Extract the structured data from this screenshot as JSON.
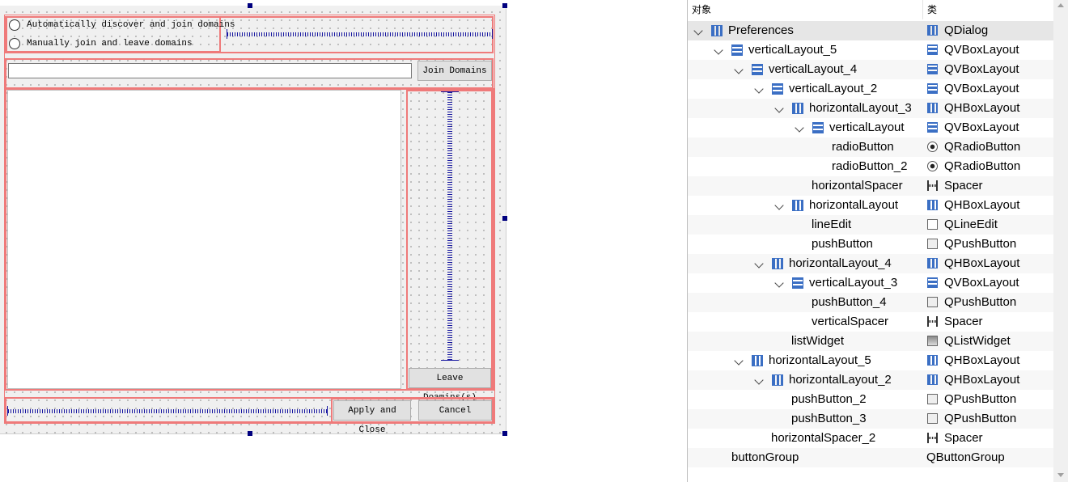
{
  "form": {
    "radio_auto": "Automatically discover and join domains",
    "radio_manual": "Manually join and leave domains",
    "line_edit_value": "",
    "join_button": "Join Domains",
    "leave_button": "Leave Doamins(s)",
    "apply_button": "Apply and Close",
    "cancel_button": "Cancel"
  },
  "inspector": {
    "header_object": "对象",
    "header_class": "类",
    "rows": [
      {
        "name": "Preferences",
        "class": "QDialog",
        "icon": "hbox-layout-icon",
        "expanded": true
      },
      {
        "name": "verticalLayout_5",
        "class": "QVBoxLayout",
        "icon": "vbox-layout-icon",
        "expanded": true
      },
      {
        "name": "verticalLayout_4",
        "class": "QVBoxLayout",
        "icon": "vbox-layout-icon",
        "expanded": true
      },
      {
        "name": "verticalLayout_2",
        "class": "QVBoxLayout",
        "icon": "vbox-layout-icon",
        "expanded": true
      },
      {
        "name": "horizontalLayout_3",
        "class": "QHBoxLayout",
        "icon": "hbox-layout-icon",
        "expanded": true
      },
      {
        "name": "verticalLayout",
        "class": "QVBoxLayout",
        "icon": "vbox-layout-icon",
        "expanded": true
      },
      {
        "name": "radioButton",
        "class": "QRadioButton",
        "icon": "radio-button-icon"
      },
      {
        "name": "radioButton_2",
        "class": "QRadioButton",
        "icon": "radio-button-icon"
      },
      {
        "name": "horizontalSpacer",
        "class": "Spacer",
        "icon": "spacer-icon"
      },
      {
        "name": "horizontalLayout",
        "class": "QHBoxLayout",
        "icon": "hbox-layout-icon",
        "expanded": true
      },
      {
        "name": "lineEdit",
        "class": "QLineEdit",
        "icon": "line-edit-icon"
      },
      {
        "name": "pushButton",
        "class": "QPushButton",
        "icon": "push-button-icon"
      },
      {
        "name": "horizontalLayout_4",
        "class": "QHBoxLayout",
        "icon": "hbox-layout-icon",
        "expanded": true
      },
      {
        "name": "verticalLayout_3",
        "class": "QVBoxLayout",
        "icon": "vbox-layout-icon",
        "expanded": true
      },
      {
        "name": "pushButton_4",
        "class": "QPushButton",
        "icon": "push-button-icon"
      },
      {
        "name": "verticalSpacer",
        "class": "Spacer",
        "icon": "spacer-icon"
      },
      {
        "name": "listWidget",
        "class": "QListWidget",
        "icon": "list-widget-icon"
      },
      {
        "name": "horizontalLayout_5",
        "class": "QHBoxLayout",
        "icon": "hbox-layout-icon",
        "expanded": true
      },
      {
        "name": "horizontalLayout_2",
        "class": "QHBoxLayout",
        "icon": "hbox-layout-icon",
        "expanded": true
      },
      {
        "name": "pushButton_2",
        "class": "QPushButton",
        "icon": "push-button-icon"
      },
      {
        "name": "pushButton_3",
        "class": "QPushButton",
        "icon": "push-button-icon"
      },
      {
        "name": "horizontalSpacer_2",
        "class": "Spacer",
        "icon": "spacer-icon"
      },
      {
        "name": "buttonGroup",
        "class": "QButtonGroup"
      }
    ]
  }
}
